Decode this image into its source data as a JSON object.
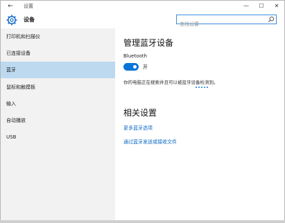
{
  "titlebar": {
    "title": "设置",
    "back": "←",
    "minimize": "—",
    "maximize": "☐",
    "close": "✕"
  },
  "header": {
    "title": "设备",
    "search_placeholder": "查找设置"
  },
  "sidebar": {
    "items": [
      {
        "label": "打印机和扫描仪"
      },
      {
        "label": "已连接设备"
      },
      {
        "label": "蓝牙"
      },
      {
        "label": "鼠标和触摸板"
      },
      {
        "label": "输入"
      },
      {
        "label": "自动播放"
      },
      {
        "label": "USB"
      }
    ],
    "active_index": 2
  },
  "main": {
    "section_title": "管理蓝牙设备",
    "bluetooth_label": "Bluetooth",
    "toggle_state": "开",
    "toggle_on": true,
    "description": "你的电脑正在搜索并且可以被蓝牙设备检测到。",
    "related_title": "相关设置",
    "links": [
      {
        "label": "更多蓝牙选项"
      },
      {
        "label": "通过蓝牙发送或接收文件"
      }
    ]
  },
  "colors": {
    "accent": "#0a74d9",
    "active_bg": "#bcd9f0",
    "sidebar_bg": "#f2f2f2"
  }
}
